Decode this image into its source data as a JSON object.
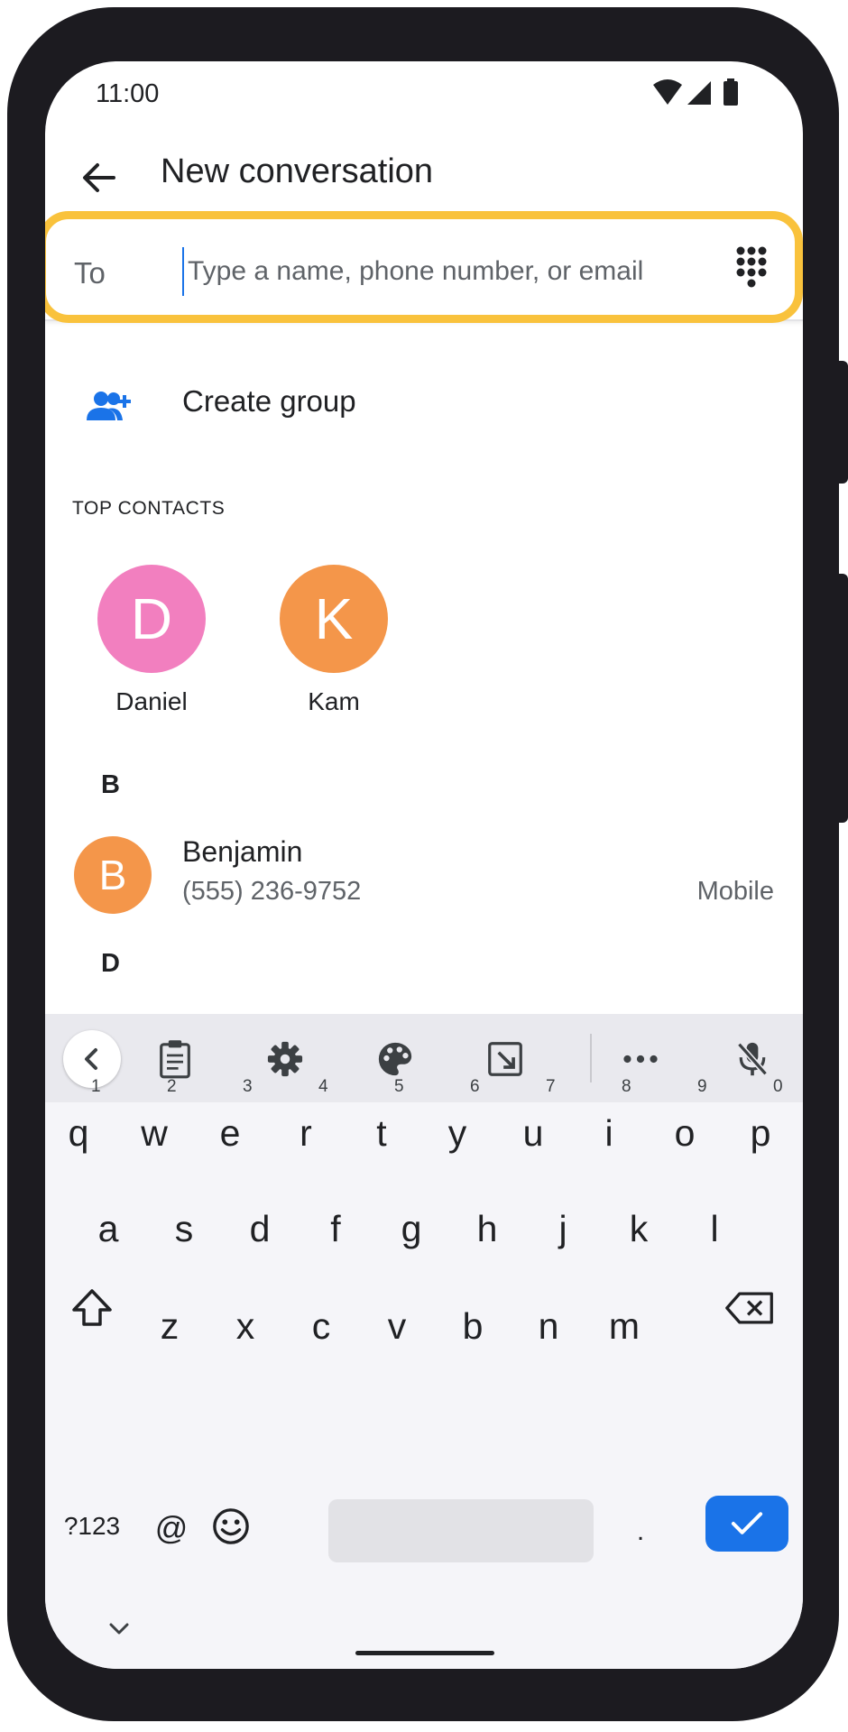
{
  "status": {
    "time": "11:00"
  },
  "header": {
    "title": "New conversation"
  },
  "to_field": {
    "label": "To",
    "placeholder": "Type a name, phone number, or email",
    "value": ""
  },
  "create_group": {
    "label": "Create group"
  },
  "top_contacts": {
    "title": "TOP CONTACTS",
    "items": [
      {
        "initial": "D",
        "name": "Daniel",
        "color": "#f27fbf"
      },
      {
        "initial": "K",
        "name": "Kam",
        "color": "#f4964a"
      }
    ]
  },
  "contacts": {
    "sections": [
      {
        "letter": "B",
        "items": [
          {
            "initial": "B",
            "name": "Benjamin",
            "phone": "(555) 236-9752",
            "type": "Mobile",
            "color": "#f4964a"
          }
        ]
      },
      {
        "letter": "D",
        "items": []
      }
    ]
  },
  "keyboard": {
    "toolbar_icons": [
      "chevron-left-icon",
      "clipboard-icon",
      "gear-icon",
      "palette-icon",
      "floating-keyboard-icon",
      "more-icon",
      "mic-off-icon"
    ],
    "row1": [
      "q",
      "w",
      "e",
      "r",
      "t",
      "y",
      "u",
      "i",
      "o",
      "p"
    ],
    "row1_hints": [
      "1",
      "2",
      "3",
      "4",
      "5",
      "6",
      "7",
      "8",
      "9",
      "0"
    ],
    "row2": [
      "a",
      "s",
      "d",
      "f",
      "g",
      "h",
      "j",
      "k",
      "l"
    ],
    "row3": [
      "z",
      "x",
      "c",
      "v",
      "b",
      "n",
      "m"
    ],
    "symbols_key": "?123",
    "at_key": "@",
    "period_key": ".",
    "accent_color": "#1a73e8"
  },
  "highlight_color": "#f9c23c"
}
